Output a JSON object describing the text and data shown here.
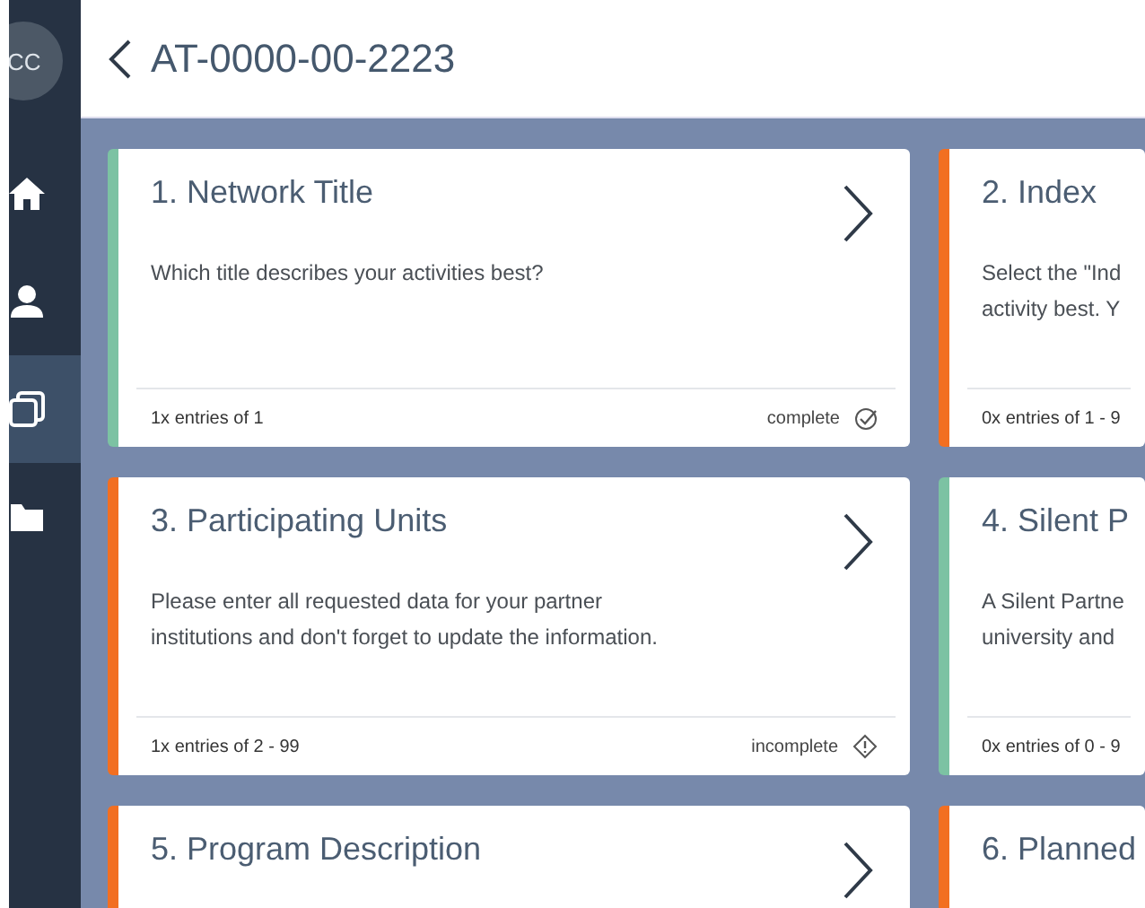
{
  "sidebar": {
    "avatar": "CC",
    "items": [
      {
        "kind": "home",
        "selected": false
      },
      {
        "kind": "person",
        "selected": false
      },
      {
        "kind": "cards",
        "selected": true
      },
      {
        "kind": "folder",
        "selected": false
      }
    ]
  },
  "header": {
    "title": "AT-0000-00-2223"
  },
  "cards": [
    {
      "title": "1. Network Title",
      "description": [
        "Which title describes your activities best?"
      ],
      "entries": "1x entries of 1",
      "status": {
        "kind": "complete",
        "label": "complete"
      },
      "color": "#7cc2a3",
      "chevron": true
    },
    {
      "title": "2. Index",
      "description": [
        "Select the \"Ind",
        "activity best. Y"
      ],
      "entries": "0x entries of 1 - 9",
      "color": "#f26f21",
      "chevron": false
    },
    {
      "title": "3. Participating Units",
      "description": [
        "Please enter all requested data for your partner",
        "institutions and don't forget to update the information."
      ],
      "entries": "1x entries of 2 - 99",
      "status": {
        "kind": "incomplete",
        "label": "incomplete"
      },
      "color": "#f26f21",
      "chevron": true
    },
    {
      "title": "4. Silent P",
      "description": [
        "A Silent Partne",
        "university and"
      ],
      "entries": "0x entries of 0 - 9",
      "color": "#7cc2a3",
      "chevron": false
    },
    {
      "title": "5. Program Description",
      "color": "#f26f21",
      "chevron": true
    },
    {
      "title": "6. Planned",
      "color": "#f26f21",
      "chevron": false
    }
  ]
}
